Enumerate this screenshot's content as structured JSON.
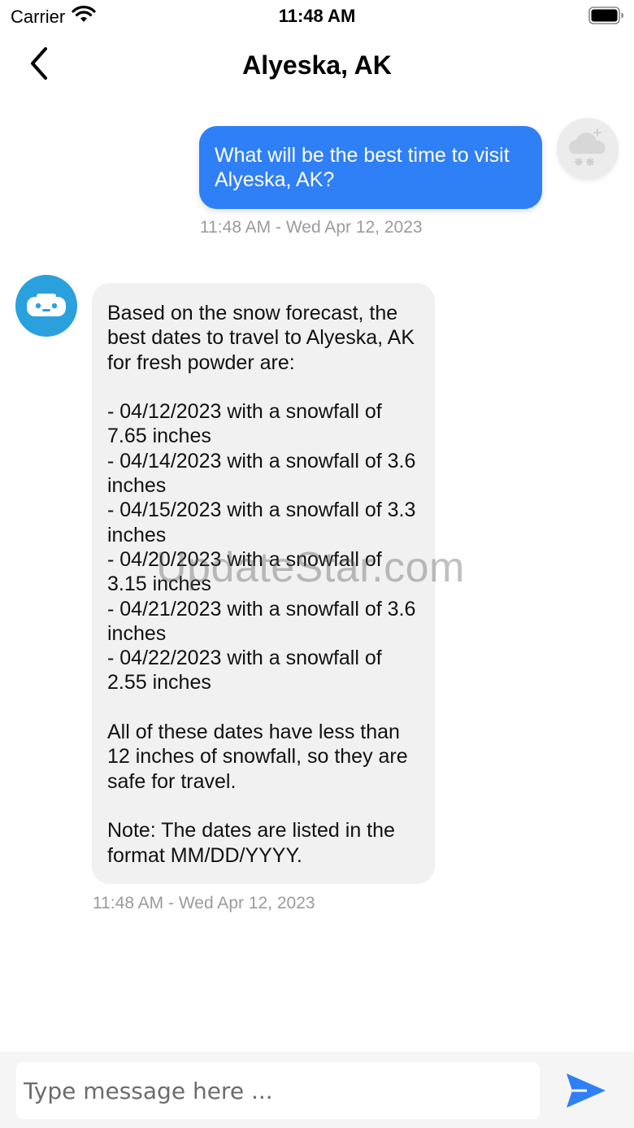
{
  "status_bar": {
    "carrier": "Carrier",
    "time": "11:48 AM"
  },
  "nav": {
    "title": "Alyeska, AK"
  },
  "messages": [
    {
      "sender": "user",
      "text": "What will be the best time to visit Alyeska, AK?",
      "timestamp": "11:48 AM - Wed Apr 12, 2023"
    },
    {
      "sender": "bot",
      "text": "Based on the snow forecast, the best dates to travel to Alyeska, AK for fresh powder are:\n\n- 04/12/2023 with a snowfall of 7.65 inches\n- 04/14/2023 with a snowfall of 3.6 inches\n- 04/15/2023 with a snowfall of 3.3 inches\n- 04/20/2023 with a snowfall of 3.15 inches\n- 04/21/2023 with a snowfall of 3.6 inches\n- 04/22/2023 with a snowfall of 2.55 inches\n\nAll of these dates have less than 12 inches of snowfall, so they are safe for travel.\n\nNote: The dates are listed in the format MM/DD/YYYY.",
      "timestamp": "11:48 AM - Wed Apr 12, 2023"
    }
  ],
  "watermark": "UpdateStar.com",
  "composer": {
    "placeholder": "Type message here ..."
  },
  "colors": {
    "user_bubble": "#2f7ff7",
    "bot_bubble": "#f1f1f1",
    "bot_avatar": "#2aa1dd",
    "send_icon": "#2f7ff7"
  },
  "icons": {
    "back": "chevron-left-icon",
    "user_avatar": "snow-cloud-icon",
    "bot_avatar": "robot-icon",
    "send": "send-icon"
  }
}
